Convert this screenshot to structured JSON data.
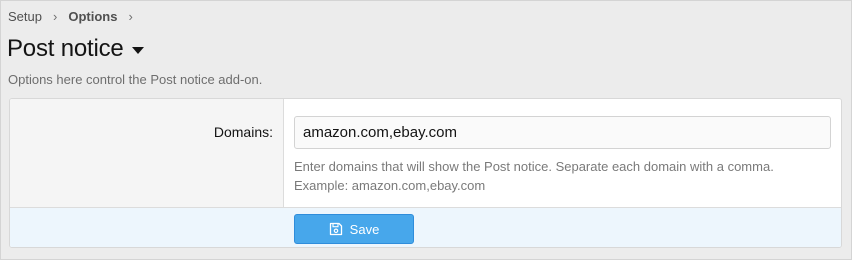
{
  "breadcrumb": {
    "items": [
      "Setup",
      "Options"
    ],
    "separator": "›"
  },
  "page": {
    "title": "Post notice",
    "description": "Options here control the Post notice add-on."
  },
  "form": {
    "domains": {
      "label": "Domains:",
      "value": "amazon.com,ebay.com",
      "hint_line1": "Enter domains that will show the Post notice. Separate each domain with a comma.",
      "hint_line2": "Example: amazon.com,ebay.com"
    },
    "save_label": "Save"
  },
  "colors": {
    "accent": "#47a7eb",
    "submit_row_bg": "#edf6fd",
    "page_bg": "#ececec"
  },
  "icons": {
    "title_menu": "caret-down-icon",
    "save": "floppy-disk-icon"
  }
}
